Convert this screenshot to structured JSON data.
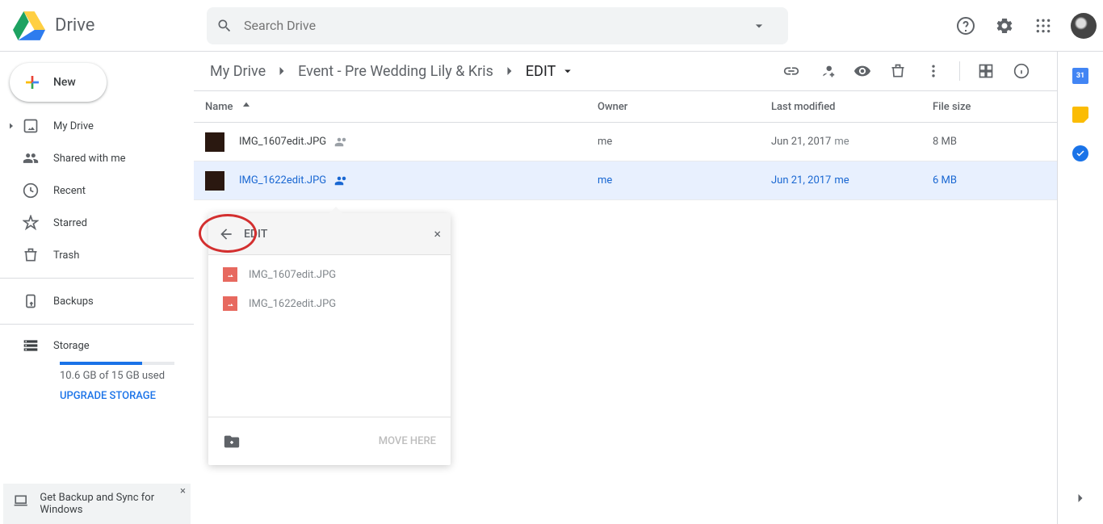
{
  "header": {
    "product": "Drive",
    "search_placeholder": "Search Drive"
  },
  "sidebar": {
    "new_label": "New",
    "items": [
      {
        "label": "My Drive",
        "icon": "drive"
      },
      {
        "label": "Shared with me",
        "icon": "shared"
      },
      {
        "label": "Recent",
        "icon": "recent"
      },
      {
        "label": "Starred",
        "icon": "star"
      },
      {
        "label": "Trash",
        "icon": "trash"
      }
    ],
    "backups_label": "Backups",
    "storage_label": "Storage",
    "storage_text": "10.6 GB of 15 GB used",
    "upgrade_label": "UPGRADE STORAGE",
    "promo_text": "Get Backup and Sync for Windows"
  },
  "breadcrumbs": [
    "My Drive",
    "Event - Pre Wedding Lily & Kris",
    "EDIT"
  ],
  "columns": {
    "name": "Name",
    "owner": "Owner",
    "modified": "Last modified",
    "size": "File size"
  },
  "files": [
    {
      "name": "IMG_1607edit.JPG",
      "owner": "me",
      "modified": "Jun 21, 2017",
      "mod_by": "me",
      "size": "8 MB",
      "selected": false
    },
    {
      "name": "IMG_1622edit.JPG",
      "owner": "me",
      "modified": "Jun 21, 2017",
      "mod_by": "me",
      "size": "6 MB",
      "selected": true
    }
  ],
  "move_popup": {
    "title": "EDIT",
    "items": [
      "IMG_1607edit.JPG",
      "IMG_1622edit.JPG"
    ],
    "action": "MOVE HERE"
  },
  "right_apps": {
    "cal": "31"
  }
}
